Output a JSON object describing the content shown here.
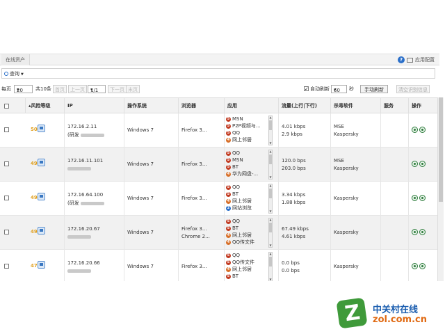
{
  "tabbar": {
    "tab_label": "在线资产",
    "help": "?",
    "app_config": "应用配置"
  },
  "query": {
    "label": "查询"
  },
  "pager": {
    "per_page_label": "每页",
    "per_page_value": "20",
    "total": "共10条",
    "first": "首页",
    "prev": "上一页",
    "page_value": "1/1",
    "next": "下一页",
    "last": "末页",
    "auto_refresh_label": "自动刷新",
    "auto_refresh_checked": true,
    "refresh_value": "60",
    "refresh_unit": "秒",
    "manual_refresh": "手动刷新",
    "clear_alerts": "清空识别信息"
  },
  "columns": {
    "risk": "风险等级",
    "ip": "IP",
    "os": "操作系统",
    "browser": "浏览器",
    "apps": "应用",
    "traffic": "流量(上行|下行)",
    "antivirus": "杀毒软件",
    "service": "服务",
    "action": "操作"
  },
  "rows": [
    {
      "score": "50",
      "ip": "172.16.2.11",
      "ip_note": "(研发",
      "os": "Windows 7",
      "browser": [
        "Firefox 3..."
      ],
      "apps": [
        {
          "badge": "5",
          "name": "MSN"
        },
        {
          "badge": "5",
          "name": "P2P视频与..."
        },
        {
          "badge": "5",
          "name": "QQ"
        },
        {
          "badge": "4",
          "name": "网上邻居"
        }
      ],
      "up": "4.01 kbps",
      "down": "2.9 kbps",
      "av": [
        "MSE",
        "Kaspersky"
      ]
    },
    {
      "score": "49",
      "ip": "172.16.11.101",
      "ip_note": "",
      "os": "Windows 7",
      "browser": [
        "Firefox 3..."
      ],
      "apps": [
        {
          "badge": "5",
          "name": "QQ"
        },
        {
          "badge": "5",
          "name": "MSN"
        },
        {
          "badge": "5",
          "name": "BT"
        },
        {
          "badge": "4",
          "name": "华为网盘-..."
        }
      ],
      "up": "120.0 bps",
      "down": "203.0 bps",
      "av": [
        "MSE",
        "Kaspersky"
      ]
    },
    {
      "score": "49",
      "ip": "172.16.64.100",
      "ip_note": "(研发",
      "os": "Windows 7",
      "browser": [
        "Firefox 3..."
      ],
      "apps": [
        {
          "badge": "5",
          "name": "QQ"
        },
        {
          "badge": "5",
          "name": "BT"
        },
        {
          "badge": "4",
          "name": "网上邻居"
        },
        {
          "badge": "2",
          "name": "网站浏览"
        }
      ],
      "up": "3.34 kbps",
      "down": "1.88 kbps",
      "av": [
        "Kaspersky"
      ]
    },
    {
      "score": "49",
      "ip": "172.16.20.67",
      "ip_note": "",
      "os": "Windows 7",
      "browser": [
        "Firefox 3...",
        "Chrome 2..."
      ],
      "apps": [
        {
          "badge": "5",
          "name": "QQ"
        },
        {
          "badge": "5",
          "name": "BT"
        },
        {
          "badge": "4",
          "name": "网上邻居"
        },
        {
          "badge": "4",
          "name": "QQ传文件"
        }
      ],
      "up": "67.49 kbps",
      "down": "4.61 kbps",
      "av": [
        "Kaspersky"
      ]
    },
    {
      "score": "47",
      "ip": "172.16.20.66",
      "ip_note": "",
      "os": "Windows 7",
      "browser": [
        "Firefox 3..."
      ],
      "apps": [
        {
          "badge": "5",
          "name": "QQ"
        },
        {
          "badge": "5",
          "name": "QQ传文件"
        },
        {
          "badge": "4",
          "name": "网上邻居"
        },
        {
          "badge": "5",
          "name": "BT"
        }
      ],
      "up": "0.0 bps",
      "down": "0.0 bps",
      "av": [
        "Kaspersky"
      ]
    }
  ],
  "logo": {
    "cn": "中关村在线",
    "en": "zol.com.cn"
  }
}
